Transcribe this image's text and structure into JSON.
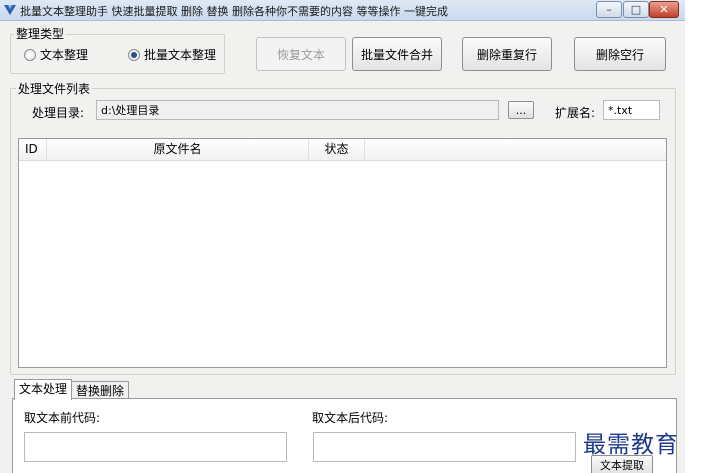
{
  "window": {
    "title": "批量文本整理助手  快速批量提取 删除 替换 删除各种你不需要的内容 等等操作 一键完成",
    "controls": {
      "minimize": "–",
      "maximize": "□",
      "close": "✕"
    }
  },
  "organize_type": {
    "label": "整理类型",
    "options": [
      {
        "label": "文本整理",
        "checked": false
      },
      {
        "label": "批量文本整理",
        "checked": true
      }
    ]
  },
  "toolbar": {
    "restore": "恢复文本",
    "merge": "批量文件合并",
    "dedupe": "删除重复行",
    "remove_blank": "删除空行"
  },
  "file_list": {
    "label": "处理文件列表",
    "dir_label": "处理目录:",
    "dir_value": "d:\\处理目录",
    "browse": "...",
    "ext_label": "扩展名:",
    "ext_value": "*.txt",
    "columns": [
      "ID",
      "原文件名",
      "状态"
    ]
  },
  "tabs": [
    {
      "label": "文本处理",
      "active": true
    },
    {
      "label": "替换删除",
      "active": false
    }
  ],
  "text_processing": {
    "before_label": "取文本前代码:",
    "after_label": "取文本后代码:",
    "extract_button": "文本提取"
  },
  "watermark": "最需教育",
  "colors": {
    "titlebar": "#c9d9ee",
    "close_button": "#c0412b",
    "watermark": "#1d3a8a"
  }
}
